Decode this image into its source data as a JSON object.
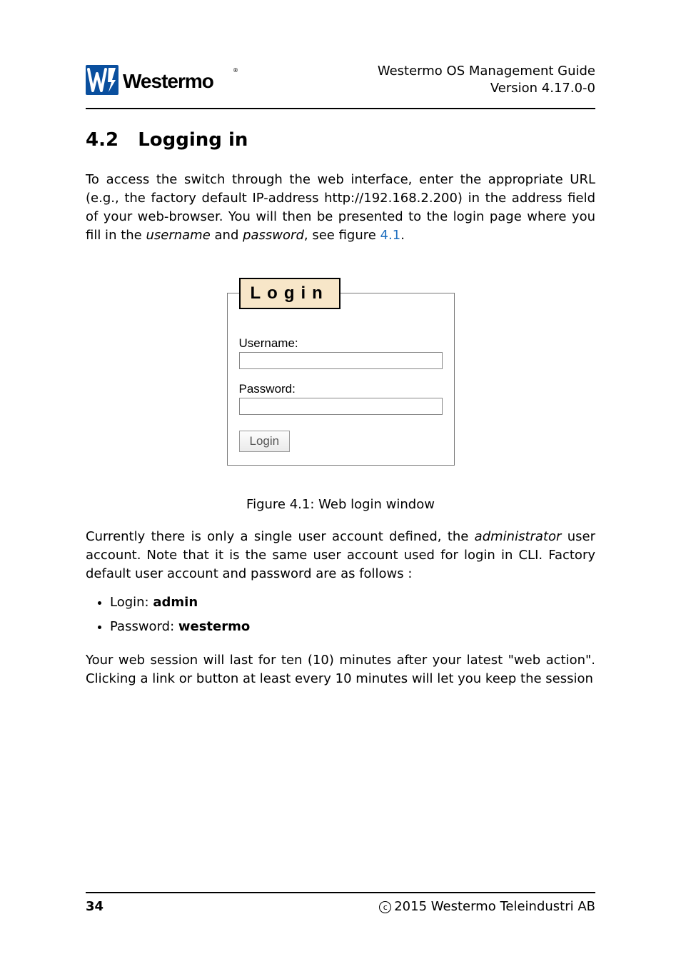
{
  "header": {
    "logo_text": "Westermo",
    "title_line1": "Westermo OS Management Guide",
    "title_line2": "Version 4.17.0-0"
  },
  "section": {
    "number": "4.2",
    "title": "Logging in"
  },
  "para1_a": "To access the switch through the web interface, enter the appropriate URL (e.g., the factory default IP-address http://192.168.2.200) in the address field of your web-browser.  You will then be presented to the login page where you fill in the ",
  "para1_username": "username",
  "para1_and": " and ",
  "para1_password": "password",
  "para1_b": ", see figure ",
  "para1_figref": "4.1",
  "para1_c": ".",
  "login_form": {
    "legend": "Login",
    "username_label": "Username:",
    "username_value": "",
    "password_label": "Password:",
    "password_value": "",
    "button": "Login"
  },
  "caption": "Figure 4.1: Web login window",
  "para2_a": "Currently there is only a single user account defined, the ",
  "para2_admin": "administrator",
  "para2_b": " user account. Note that it is the same user account used for login in CLI. Factory default user account and password are as follows :",
  "credentials": {
    "login_label": "Login: ",
    "login_value": "admin",
    "password_label": "Password: ",
    "password_value": "westermo"
  },
  "para3": "Your web session will last for ten (10) minutes after your latest \"web action\". Clicking a link or button at least every 10 minutes will let you keep the session",
  "footer": {
    "page": "34",
    "copyright": "2015 Westermo Teleindustri AB"
  }
}
